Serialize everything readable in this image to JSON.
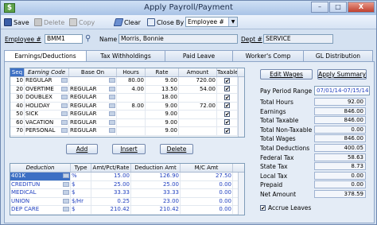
{
  "window": {
    "title": "Apply Payroll/Payment",
    "min": "–",
    "max": "□",
    "close": "X"
  },
  "toolbar": {
    "save": "Save",
    "delete": "Delete",
    "copy": "Copy",
    "clear": "Clear",
    "close": "Close",
    "by_label": "By",
    "by_value": "Employee #"
  },
  "employee": {
    "num_label": "Employee #",
    "num_value": "BMM1",
    "name_label": "Name",
    "name_value": "Morris, Bonnie",
    "dept_label": "Dept #",
    "dept_value": "SERVICE"
  },
  "tabs": [
    "Earnings/Deductions",
    "Tax Withholdings",
    "Paid Leave",
    "Worker's Comp",
    "GL Distribution"
  ],
  "earnings": {
    "headers": [
      "Seq",
      "Earning Code",
      "Base On",
      "Hours",
      "Rate",
      "Amount",
      "Taxable"
    ],
    "rows": [
      {
        "seq": "10",
        "code": "REGULAR",
        "base": "",
        "hours": "80.00",
        "rate": "9.00",
        "amount": "720.00",
        "taxable": "✔"
      },
      {
        "seq": "20",
        "code": "OVERTIME",
        "base": "REGULAR",
        "hours": "4.00",
        "rate": "13.50",
        "amount": "54.00",
        "taxable": "✔"
      },
      {
        "seq": "30",
        "code": "DOUBLEX",
        "base": "REGULAR",
        "hours": "",
        "rate": "18.00",
        "amount": "",
        "taxable": "✔"
      },
      {
        "seq": "40",
        "code": "HOLIDAY",
        "base": "REGULAR",
        "hours": "8.00",
        "rate": "9.00",
        "amount": "72.00",
        "taxable": "✔"
      },
      {
        "seq": "50",
        "code": "SICK",
        "base": "REGULAR",
        "hours": "",
        "rate": "9.00",
        "amount": "",
        "taxable": "✔"
      },
      {
        "seq": "60",
        "code": "VACATION",
        "base": "REGULAR",
        "hours": "",
        "rate": "9.00",
        "amount": "",
        "taxable": "✔"
      },
      {
        "seq": "70",
        "code": "PERSONAL",
        "base": "REGULAR",
        "hours": "",
        "rate": "9.00",
        "amount": "",
        "taxable": "✔"
      }
    ]
  },
  "buttons": {
    "add": "Add",
    "insert": "Insert",
    "delete": "Delete",
    "edit_wages": "Edit Wages",
    "apply_summary": "Apply Summary"
  },
  "deductions": {
    "headers": [
      "Deduction",
      "Type",
      "Amt/Pct/Rate",
      "Deduction Amt",
      "M/C Amt"
    ],
    "rows": [
      {
        "name": "401K",
        "type": "%",
        "amt": "15.00",
        "ded": "126.90",
        "mc": "27.50"
      },
      {
        "name": "CREDITUN",
        "type": "$",
        "amt": "25.00",
        "ded": "25.00",
        "mc": "0.00"
      },
      {
        "name": "MEDICAL",
        "type": "$",
        "amt": "33.33",
        "ded": "33.33",
        "mc": "0.00"
      },
      {
        "name": "UNION",
        "type": "$/Hr",
        "amt": "0.25",
        "ded": "23.00",
        "mc": "0.00"
      },
      {
        "name": "DEP CARE",
        "type": "$",
        "amt": "210.42",
        "ded": "210.42",
        "mc": "0.00"
      }
    ]
  },
  "summary": {
    "pay_period_label": "Pay Period Range",
    "pay_period_value": "07/01/14-07/15/14",
    "items": [
      {
        "label": "Total Hours",
        "value": "92.00"
      },
      {
        "label": "Earnings",
        "value": "846.00"
      },
      {
        "label": "Total Taxable",
        "value": "846.00"
      },
      {
        "label": "Total Non-Taxable",
        "value": "0.00"
      },
      {
        "label": "Total Wages",
        "value": "846.00"
      },
      {
        "label": "Total Deductions",
        "value": "400.05"
      },
      {
        "label": "Federal Tax",
        "value": "58.63"
      },
      {
        "label": "State Tax",
        "value": "8.73"
      },
      {
        "label": "Local Tax",
        "value": "0.00"
      },
      {
        "label": "Prepaid",
        "value": "0.00"
      },
      {
        "label": "Net Amount",
        "value": "378.59"
      }
    ],
    "accrue_label": "Accrue Leaves"
  }
}
